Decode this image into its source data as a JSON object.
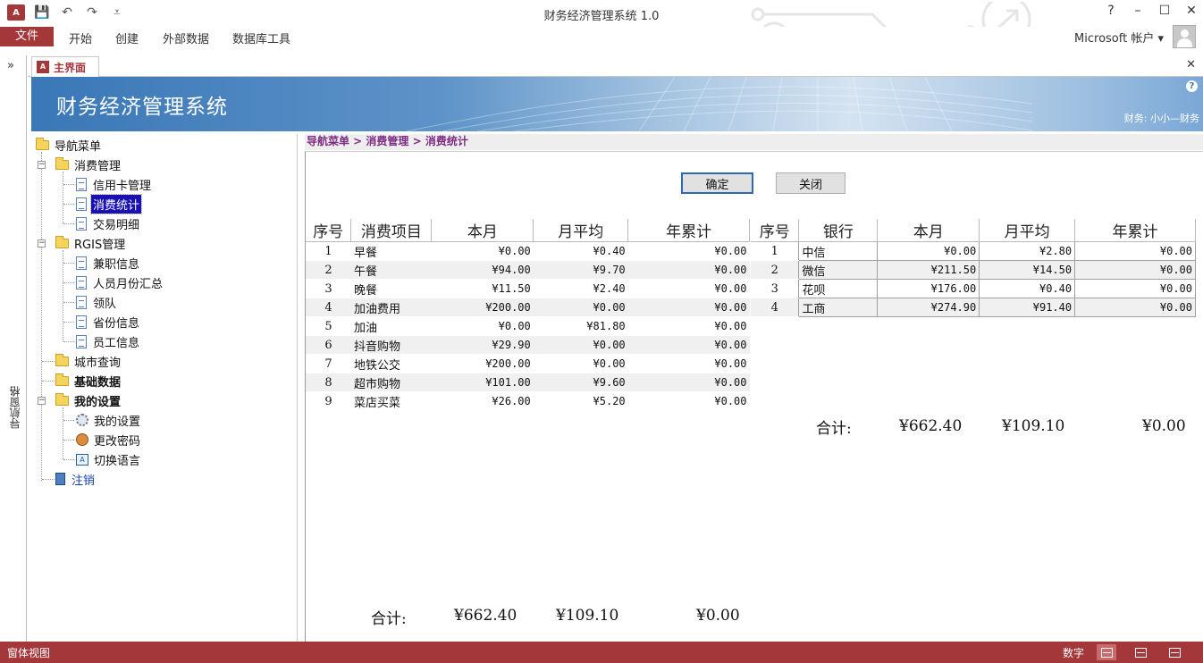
{
  "window": {
    "title": "财务经济管理系统 1.0",
    "help": "?",
    "minimize": "–",
    "maximize": "☐",
    "close": "✕"
  },
  "qat": {
    "app_icon": "A",
    "save": "💾",
    "undo": "↶",
    "redo": "↷",
    "customize": "⩡"
  },
  "ribbon": {
    "file": "文件",
    "tabs": [
      "开始",
      "创建",
      "外部数据",
      "数据库工具"
    ],
    "account": "Microsoft 帐户 ▾"
  },
  "navpane": {
    "expand": "»",
    "label": "导航窗格"
  },
  "doctab": {
    "icon": "A",
    "label": "主界面",
    "close": "✕"
  },
  "banner": {
    "title": "财务经济管理系统",
    "help": "?",
    "user": "财务: 小小—财务"
  },
  "tree": {
    "root": "导航菜单",
    "items": [
      {
        "label": "消费管理"
      },
      {
        "label": "信用卡管理"
      },
      {
        "label": "消费统计"
      },
      {
        "label": "交易明细"
      },
      {
        "label": "RGIS管理"
      },
      {
        "label": "兼职信息"
      },
      {
        "label": "人员月份汇总"
      },
      {
        "label": "领队"
      },
      {
        "label": "省份信息"
      },
      {
        "label": "员工信息"
      },
      {
        "label": "城市查询"
      },
      {
        "label": "基础数据"
      },
      {
        "label": "我的设置"
      },
      {
        "label": "我的设置"
      },
      {
        "label": "更改密码"
      },
      {
        "label": "切换语言"
      },
      {
        "label": "注销"
      }
    ]
  },
  "breadcrumb": "导航菜单 > 消费管理 > 消费统计",
  "buttons": {
    "confirm": "确定",
    "close": "关闭"
  },
  "expense_table": {
    "headers": [
      "序号",
      "消费项目",
      "本月",
      "月平均",
      "年累计"
    ],
    "rows": [
      [
        "1",
        "早餐",
        "¥0.00",
        "¥0.40",
        "¥0.00"
      ],
      [
        "2",
        "午餐",
        "¥94.00",
        "¥9.70",
        "¥0.00"
      ],
      [
        "3",
        "晚餐",
        "¥11.50",
        "¥2.40",
        "¥0.00"
      ],
      [
        "4",
        "加油费用",
        "¥200.00",
        "¥0.00",
        "¥0.00"
      ],
      [
        "5",
        "加油",
        "¥0.00",
        "¥81.80",
        "¥0.00"
      ],
      [
        "6",
        "抖音购物",
        "¥29.90",
        "¥0.00",
        "¥0.00"
      ],
      [
        "7",
        "地铁公交",
        "¥200.00",
        "¥0.00",
        "¥0.00"
      ],
      [
        "8",
        "超市购物",
        "¥101.00",
        "¥9.60",
        "¥0.00"
      ],
      [
        "9",
        "菜店买菜",
        "¥26.00",
        "¥5.20",
        "¥0.00"
      ]
    ],
    "total_label": "合计:",
    "totals": [
      "¥662.40",
      "¥109.10",
      "¥0.00"
    ]
  },
  "bank_table": {
    "headers": [
      "序号",
      "银行",
      "本月",
      "月平均",
      "年累计"
    ],
    "rows": [
      [
        "1",
        "中信",
        "¥0.00",
        "¥2.80",
        "¥0.00"
      ],
      [
        "2",
        "微信",
        "¥211.50",
        "¥14.50",
        "¥0.00"
      ],
      [
        "3",
        "花呗",
        "¥176.00",
        "¥0.40",
        "¥0.00"
      ],
      [
        "4",
        "工商",
        "¥274.90",
        "¥91.40",
        "¥0.00"
      ]
    ],
    "total_label": "合计:",
    "totals": [
      "¥662.40",
      "¥109.10",
      "¥0.00"
    ]
  },
  "status": {
    "view": "窗体视图",
    "mode": "数字"
  },
  "colors": {
    "accent": "#a4373a",
    "selection": "#1a11b5",
    "breadcrumb": "#7d2b82",
    "banner": "#3a77b7"
  }
}
